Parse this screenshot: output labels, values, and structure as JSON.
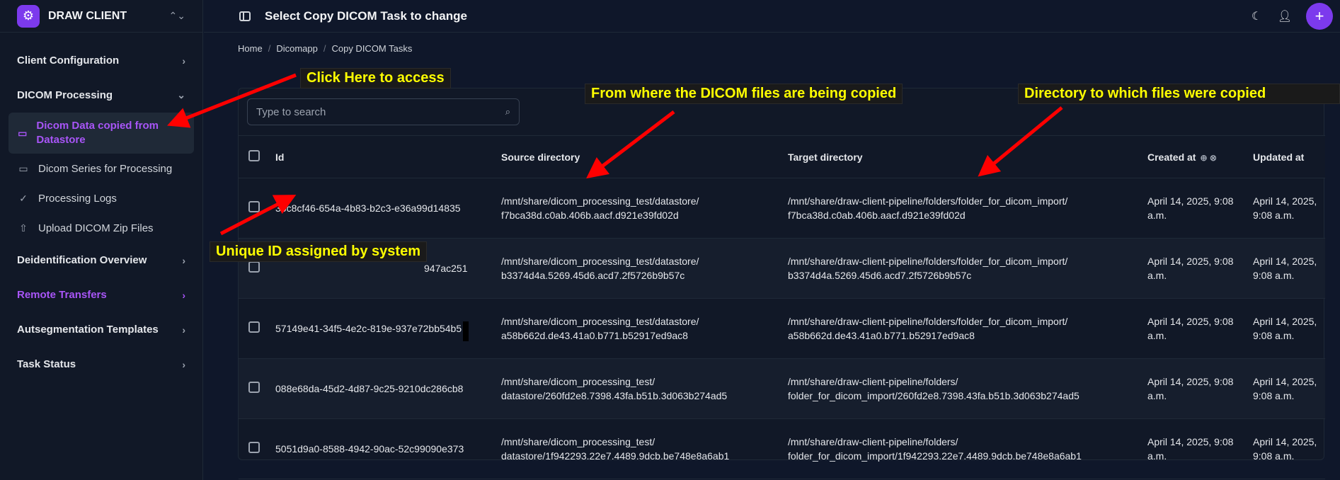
{
  "app": {
    "title": "DRAW CLIENT"
  },
  "header": {
    "title": "Select Copy DICOM Task to change"
  },
  "sidebar": {
    "sections": [
      {
        "label": "Client Configuration"
      },
      {
        "label": "DICOM Processing"
      },
      {
        "label": "Deidentification Overview"
      },
      {
        "label": "Remote Transfers"
      },
      {
        "label": "Autsegmentation Templates"
      },
      {
        "label": "Task Status"
      }
    ],
    "dicom_items": [
      {
        "label": "Dicom Data copied from Datastore"
      },
      {
        "label": "Dicom Series for Processing"
      },
      {
        "label": "Processing Logs"
      },
      {
        "label": "Upload DICOM Zip Files"
      }
    ]
  },
  "breadcrumb": [
    "Home",
    "Dicomapp",
    "Copy DICOM Tasks"
  ],
  "search": {
    "placeholder": "Type to search"
  },
  "table": {
    "headers": {
      "id": "Id",
      "source": "Source directory",
      "target": "Target directory",
      "created": "Created at",
      "updated": "Updated at"
    },
    "rows": [
      {
        "id": "36c8cf46-654a-4b83-b2c3-e36a99d14835",
        "source": "/mnt/share/dicom_processing_test/datastore/ f7bca38d.c0ab.406b.aacf.d921e39fd02d",
        "target": "/mnt/share/draw-client-pipeline/folders/folder_for_dicom_import/ f7bca38d.c0ab.406b.aacf.d921e39fd02d",
        "created": "April 14, 2025, 9:08 a.m.",
        "updated": "April 14, 2025, 9:08 a.m."
      },
      {
        "id": "947ac251",
        "source": "/mnt/share/dicom_processing_test/datastore/ b3374d4a.5269.45d6.acd7.2f5726b9b57c",
        "target": "/mnt/share/draw-client-pipeline/folders/folder_for_dicom_import/ b3374d4a.5269.45d6.acd7.2f5726b9b57c",
        "created": "April 14, 2025, 9:08 a.m.",
        "updated": "April 14, 2025, 9:08 a.m."
      },
      {
        "id": "57149e41-34f5-4e2c-819e-937e72bb54b5",
        "source": "/mnt/share/dicom_processing_test/datastore/ a58b662d.de43.41a0.b771.b52917ed9ac8",
        "target": "/mnt/share/draw-client-pipeline/folders/folder_for_dicom_import/ a58b662d.de43.41a0.b771.b52917ed9ac8",
        "created": "April 14, 2025, 9:08 a.m.",
        "updated": "April 14, 2025, 9:08 a.m."
      },
      {
        "id": "088e68da-45d2-4d87-9c25-9210dc286cb8",
        "source": "/mnt/share/dicom_processing_test/ datastore/260fd2e8.7398.43fa.b51b.3d063b274ad5",
        "target": "/mnt/share/draw-client-pipeline/folders/ folder_for_dicom_import/260fd2e8.7398.43fa.b51b.3d063b274ad5",
        "created": "April 14, 2025, 9:08 a.m.",
        "updated": "April 14, 2025, 9:08 a.m."
      },
      {
        "id": "5051d9a0-8588-4942-90ac-52c99090e373",
        "source": "/mnt/share/dicom_processing_test/ datastore/1f942293.22e7.4489.9dcb.be748e8a6ab1",
        "target": "/mnt/share/draw-client-pipeline/folders/ folder_for_dicom_import/1f942293.22e7.4489.9dcb.be748e8a6ab1",
        "created": "April 14, 2025, 9:08 a.m.",
        "updated": "April 14, 2025, 9:08 a.m."
      }
    ]
  },
  "annotations": {
    "click_here": "Click Here to access",
    "source_note": "From where the DICOM files are being copied",
    "target_note": "Directory to which files were copied",
    "id_note": "Unique ID assigned by system"
  },
  "colors": {
    "accent": "#7c3aed",
    "accent_text": "#a855f7",
    "annotation_text": "#ffff00",
    "arrow": "#ff0000"
  },
  "icons": [
    "settings-icon",
    "chevron-updown-icon",
    "panel-toggle-icon",
    "moon-icon",
    "user-icon",
    "plus-icon",
    "folder-icon",
    "check-circle-icon",
    "upload-icon",
    "search-icon"
  ]
}
